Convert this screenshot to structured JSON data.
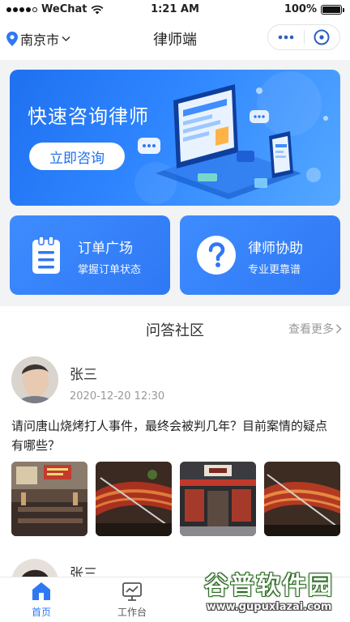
{
  "status_bar": {
    "carrier": "WeChat",
    "time": "1:21 AM",
    "battery": "100%",
    "battery_level": 1.0,
    "signal_icon": "signal-dots-icon",
    "wifi_icon": "wifi-icon"
  },
  "nav": {
    "city": "南京市",
    "title": "律师端",
    "location_icon": "location-pin-icon",
    "more_icon": "more-dots-icon",
    "close_icon": "close-circle-icon"
  },
  "banner": {
    "title": "快速咨询律师",
    "button_label": "立即咨询"
  },
  "services": [
    {
      "title": "订单广场",
      "subtitle": "掌握订单状态",
      "icon": "clipboard-list-icon"
    },
    {
      "title": "律师协助",
      "subtitle": "专业更靠谱",
      "icon": "question-circle-icon"
    }
  ],
  "community": {
    "title": "问答社区",
    "more_label": "查看更多",
    "posts": [
      {
        "author": "张三",
        "time": "2020-12-20 12:30",
        "question": "请问唐山烧烤打人事件，最终会被判几年？目前案情的疑点有哪些？",
        "photo_count": 4
      },
      {
        "author": "张三"
      }
    ]
  },
  "tab_bar": {
    "tabs": [
      {
        "label": "首页",
        "icon": "home-icon",
        "active": true
      },
      {
        "label": "工作台",
        "icon": "workbench-chart-icon",
        "active": false
      }
    ]
  },
  "watermark": {
    "main": "谷普软件园",
    "url": "www.gupuxlazai.com"
  },
  "colors": {
    "primary": "#2f78f4",
    "banner_start": "#1f70f0",
    "banner_end": "#55a8ff",
    "text": "#222222",
    "muted": "#999999"
  }
}
